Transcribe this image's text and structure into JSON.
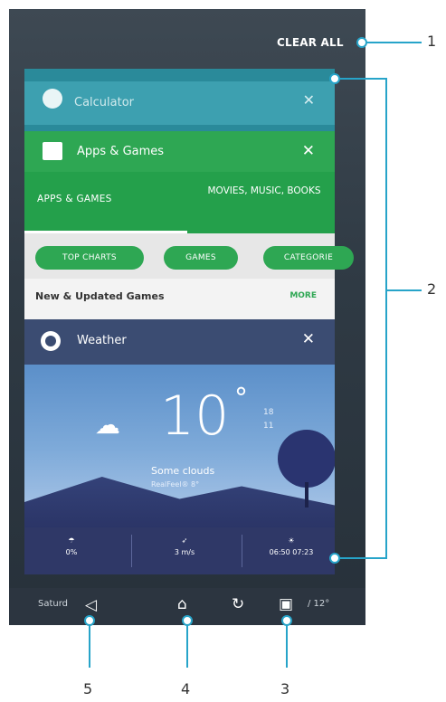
{
  "recents": {
    "clear_all": "CLEAR ALL",
    "calculator": {
      "title": "Calculator"
    },
    "apps": {
      "title": "Apps & Games",
      "tab_apps": "APPS & GAMES",
      "tab_movies": "MOVIES, MUSIC, BOOKS",
      "chips": [
        "TOP CHARTS",
        "GAMES",
        "CATEGORIE"
      ],
      "section_title": "New & Updated Games",
      "section_more": "MORE"
    },
    "weather": {
      "title": "Weather",
      "temperature": "10",
      "degree": "°",
      "high": "18",
      "low": "11",
      "condition": "Some clouds",
      "feels_like": "RealFeel® 8°",
      "precip": "0%",
      "wind": "3 m/s",
      "sun": "06:50  07:23"
    }
  },
  "nav": {
    "left_text": "Saturd",
    "right_text": "/ 12°"
  },
  "callouts": [
    "1",
    "2",
    "3",
    "4",
    "5"
  ],
  "colors": {
    "accent": "#27a4c9",
    "play_green": "#2ea753",
    "weather_blue": "#3f5d93"
  }
}
